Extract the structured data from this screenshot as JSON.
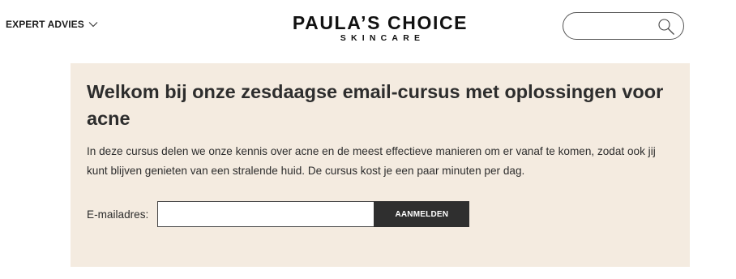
{
  "header": {
    "nav_label": "EXPERT ADVIES",
    "nav_icon": "chevron-down-icon",
    "logo_main": "PAULA’S CHOICE",
    "logo_sub": "SKINCARE",
    "search_placeholder": "",
    "search_value": "",
    "search_icon": "search-icon"
  },
  "promo": {
    "title": "Welkom bij onze zesdaagse email-cursus met oplossingen voor acne",
    "text": "In deze cursus delen we onze kennis over acne en de meest effectieve manieren om er vanaf te komen, zodat ook jij kunt blijven genieten van een stralende huid. De cursus kost je een paar minuten per dag.",
    "email_label": "E-mailadres:",
    "email_value": "",
    "email_placeholder": "",
    "submit_label": "AANMELDEN",
    "background_color": "#f4ebe0",
    "button_color": "#2f2f2f"
  }
}
